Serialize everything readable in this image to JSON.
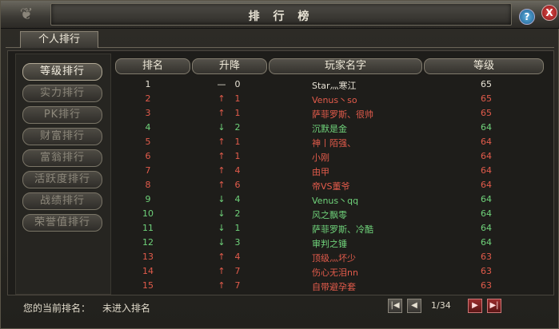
{
  "window": {
    "title": "排 行 榜"
  },
  "controls": {
    "help": "?",
    "close": "X"
  },
  "tabs": [
    {
      "label": "个人排行"
    }
  ],
  "sidebar": {
    "items": [
      {
        "label": "等级排行",
        "active": true
      },
      {
        "label": "实力排行",
        "active": false
      },
      {
        "label": "PK排行",
        "active": false
      },
      {
        "label": "财富排行",
        "active": false
      },
      {
        "label": "富翁排行",
        "active": false
      },
      {
        "label": "活跃度排行",
        "active": false
      },
      {
        "label": "战绩排行",
        "active": false
      },
      {
        "label": "荣誉值排行",
        "active": false
      }
    ]
  },
  "table": {
    "headers": [
      "排名",
      "升降",
      "玩家名字",
      "等级"
    ],
    "rows": [
      {
        "rank": "1",
        "arrow": "—",
        "change": "0",
        "name": "Star灬寒江",
        "level": "65",
        "color": "white"
      },
      {
        "rank": "2",
        "arrow": "↑",
        "change": "1",
        "name": "Venus丶so",
        "level": "65",
        "color": "red"
      },
      {
        "rank": "3",
        "arrow": "↑",
        "change": "1",
        "name": "萨菲罗斯、很帅",
        "level": "65",
        "color": "red"
      },
      {
        "rank": "4",
        "arrow": "↓",
        "change": "2",
        "name": "沉默是金",
        "level": "64",
        "color": "green"
      },
      {
        "rank": "5",
        "arrow": "↑",
        "change": "1",
        "name": "神丨陌强、",
        "level": "64",
        "color": "red"
      },
      {
        "rank": "6",
        "arrow": "↑",
        "change": "1",
        "name": "小刚",
        "level": "64",
        "color": "red"
      },
      {
        "rank": "7",
        "arrow": "↑",
        "change": "4",
        "name": "由甲",
        "level": "64",
        "color": "red"
      },
      {
        "rank": "8",
        "arrow": "↑",
        "change": "6",
        "name": "帝VS董爷",
        "level": "64",
        "color": "red"
      },
      {
        "rank": "9",
        "arrow": "↓",
        "change": "4",
        "name": "Venus丶qq",
        "level": "64",
        "color": "green"
      },
      {
        "rank": "10",
        "arrow": "↓",
        "change": "2",
        "name": "风之飘零",
        "level": "64",
        "color": "green"
      },
      {
        "rank": "11",
        "arrow": "↓",
        "change": "1",
        "name": "萨菲罗斯、冷酷",
        "level": "64",
        "color": "green"
      },
      {
        "rank": "12",
        "arrow": "↓",
        "change": "3",
        "name": "审判之锤",
        "level": "64",
        "color": "green"
      },
      {
        "rank": "13",
        "arrow": "↑",
        "change": "4",
        "name": "顶级灬坏少",
        "level": "63",
        "color": "red"
      },
      {
        "rank": "14",
        "arrow": "↑",
        "change": "7",
        "name": "伤心无泪nn",
        "level": "63",
        "color": "red"
      },
      {
        "rank": "15",
        "arrow": "↑",
        "change": "7",
        "name": "自带避孕套",
        "level": "63",
        "color": "red"
      }
    ]
  },
  "footer": {
    "current_rank_label": "您的当前排名：",
    "current_rank_value": "未进入排名",
    "page_indicator": "1/34"
  },
  "pager": {
    "first": "|◀",
    "prev": "◀",
    "next": "▶",
    "last": "▶|"
  }
}
